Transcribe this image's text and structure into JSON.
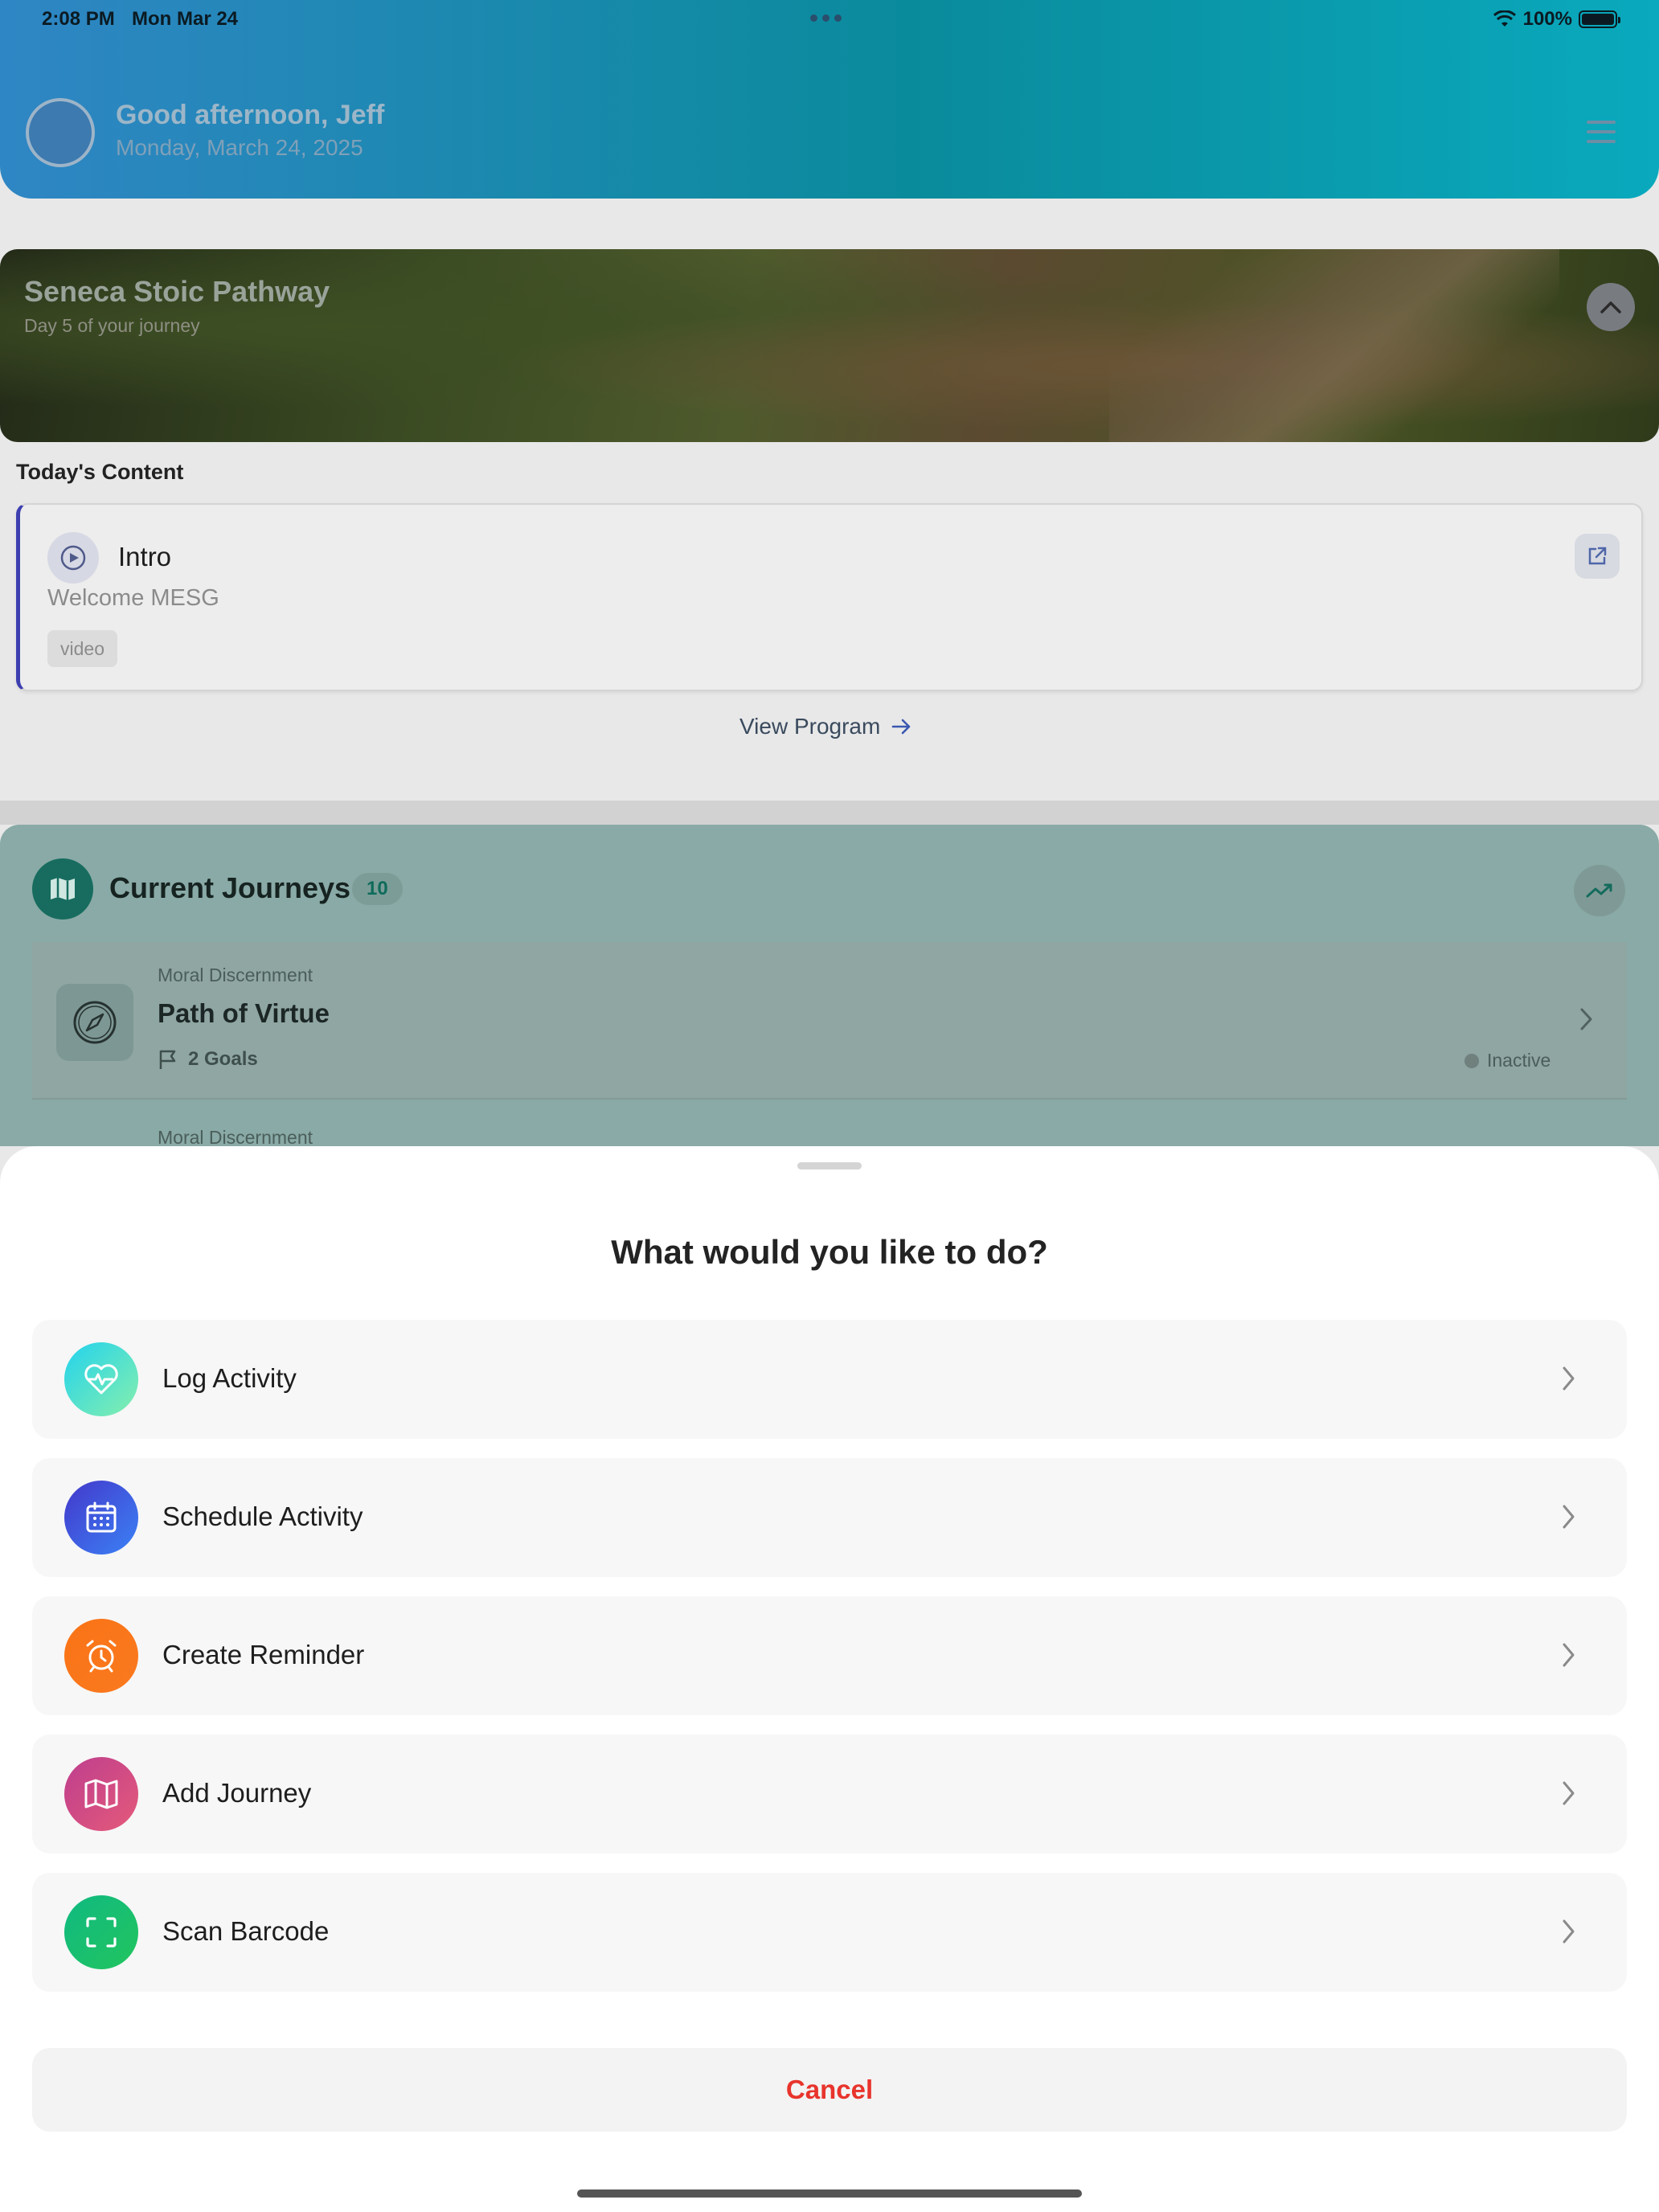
{
  "status_bar": {
    "time": "2:08 PM",
    "date": "Mon Mar 24",
    "battery": "100%"
  },
  "header": {
    "greeting": "Good afternoon, Jeff",
    "date": "Monday, March 24, 2025"
  },
  "program": {
    "title": "Seneca Stoic Pathway",
    "day": "Day 5 of your journey"
  },
  "todays_content": {
    "section_title": "Today's Content",
    "item": {
      "title": "Intro",
      "subtitle": "Welcome MESG",
      "tag": "video"
    },
    "view_program_label": "View Program"
  },
  "journeys": {
    "title": "Current Journeys",
    "count": "10",
    "items": [
      {
        "category": "Moral Discernment",
        "name": "Path of Virtue",
        "goals": "2 Goals",
        "status": "Inactive"
      },
      {
        "category": "Moral Discernment"
      }
    ]
  },
  "sheet": {
    "title": "What would you like to do?",
    "actions": [
      {
        "label": "Log Activity",
        "icon": "heart-pulse-icon",
        "color_from": "#22d3ee",
        "color_to": "#86efac"
      },
      {
        "label": "Schedule Activity",
        "icon": "calendar-icon",
        "color_from": "#4338ca",
        "color_to": "#3b82f6"
      },
      {
        "label": "Create Reminder",
        "icon": "alarm-clock-icon",
        "color_from": "#f97316",
        "color_to": "#fb7a1f"
      },
      {
        "label": "Add Journey",
        "icon": "map-icon",
        "color_from": "#be3e8e",
        "color_to": "#e45a7a"
      },
      {
        "label": "Scan Barcode",
        "icon": "scan-icon",
        "color_from": "#10b981",
        "color_to": "#22c55e"
      }
    ],
    "cancel_label": "Cancel"
  }
}
